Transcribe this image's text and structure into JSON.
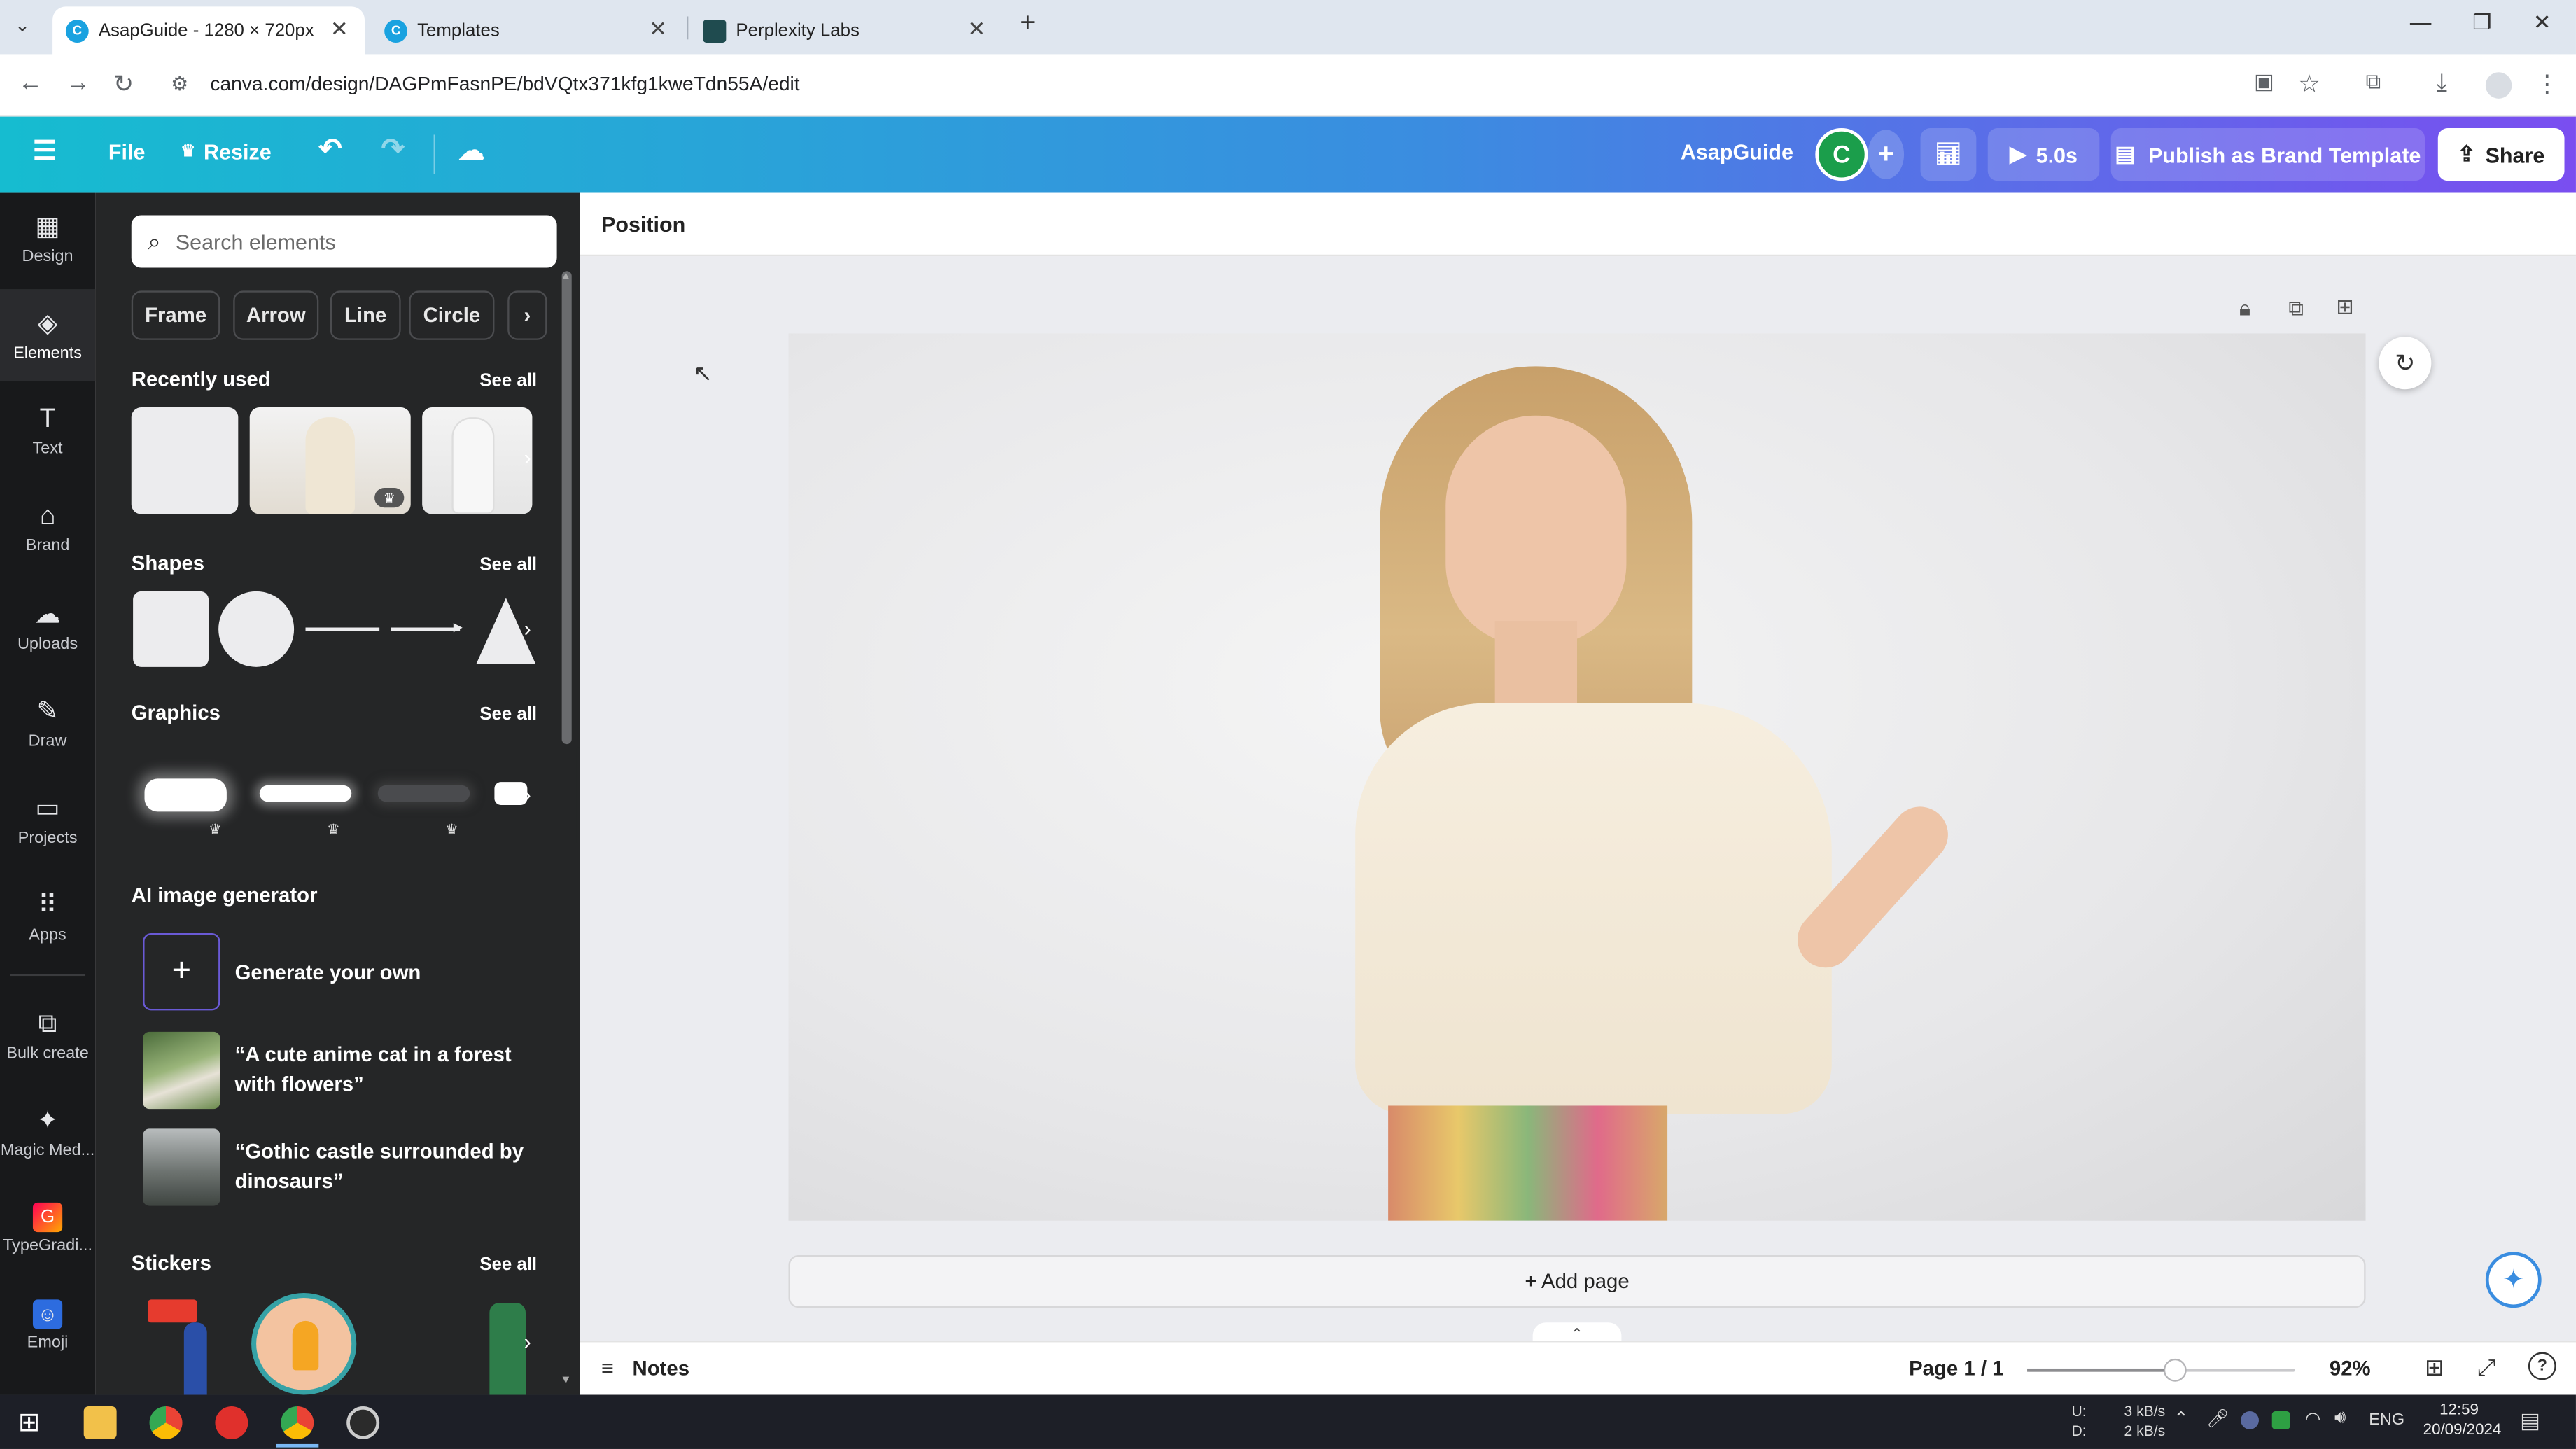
{
  "browser": {
    "tabs": [
      {
        "title": "AsapGuide - 1280 × 720px",
        "active": true
      },
      {
        "title": "Templates",
        "active": false
      },
      {
        "title": "Perplexity Labs",
        "active": false
      }
    ],
    "url": "canva.com/design/DAGPmFasnPE/bdVQtx371kfg1kweTdn55A/edit"
  },
  "header": {
    "file_label": "File",
    "resize_label": "Resize",
    "design_name": "AsapGuide",
    "avatar_letter": "C",
    "play_duration": "5.0s",
    "publish_label": "Publish as Brand Template",
    "share_label": "Share"
  },
  "rail": {
    "items": [
      {
        "label": "Design",
        "icon": "design-icon"
      },
      {
        "label": "Elements",
        "icon": "elements-icon"
      },
      {
        "label": "Text",
        "icon": "text-icon"
      },
      {
        "label": "Brand",
        "icon": "brand-icon"
      },
      {
        "label": "Uploads",
        "icon": "uploads-icon"
      },
      {
        "label": "Draw",
        "icon": "draw-icon"
      },
      {
        "label": "Projects",
        "icon": "projects-icon"
      },
      {
        "label": "Apps",
        "icon": "apps-icon"
      },
      {
        "label": "Bulk create",
        "icon": "bulk-create-icon"
      },
      {
        "label": "Magic Med...",
        "icon": "magic-media-icon"
      },
      {
        "label": "TypeGradi...",
        "icon": "typegradient-icon"
      },
      {
        "label": "Emoji",
        "icon": "emoji-icon"
      }
    ]
  },
  "panel": {
    "search_placeholder": "Search elements",
    "chips": [
      "Frame",
      "Arrow",
      "Line",
      "Circle"
    ],
    "recently_used": "Recently used",
    "shapes": "Shapes",
    "graphics": "Graphics",
    "ai_generator": "AI image generator",
    "stickers": "Stickers",
    "see_all": "See all",
    "generate_label": "Generate your own",
    "ai_prompt_1": "“A cute anime cat in a forest with flowers”",
    "ai_prompt_2": "“Gothic castle surrounded by dinosaurs”"
  },
  "canvas": {
    "toolbar_label": "Position",
    "add_page_label": "+ Add page",
    "notes_label": "Notes",
    "page_indicator": "Page 1 / 1",
    "zoom": "92%",
    "zoom_fraction": 0.55
  },
  "taskbar": {
    "net_up_label": "U:",
    "net_down_label": "D:",
    "net_up": "3 kB/s",
    "net_down": "2 kB/s",
    "lang": "ENG",
    "time": "12:59",
    "date": "20/09/2024"
  },
  "colors": {
    "canva_gradient_start": "#16bcd0",
    "canva_gradient_end": "#7a4ef0",
    "panel_bg": "#252627",
    "rail_bg": "#18191b"
  }
}
